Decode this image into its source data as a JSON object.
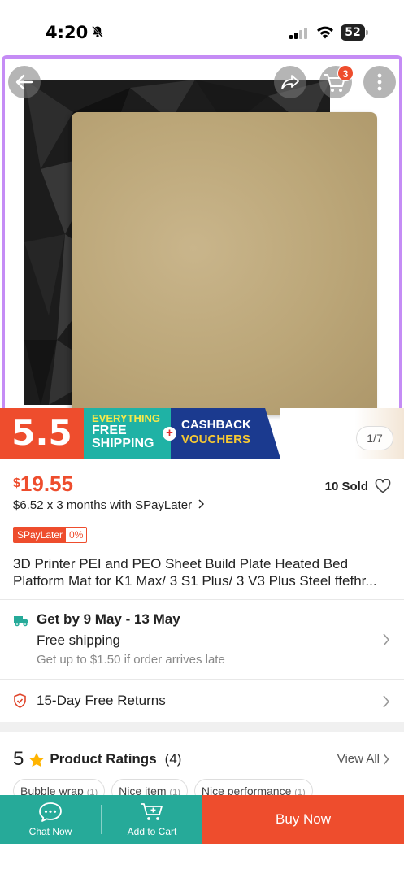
{
  "status_bar": {
    "time": "4:20",
    "battery": "52"
  },
  "hero": {
    "cart_count": "3",
    "page_counter": "1/7"
  },
  "promo": {
    "sale": "5.5",
    "line1": "EVERYTHING",
    "line2": "FREE",
    "line3": "SHIPPING",
    "plus": "+",
    "cash1": "CASHBACK",
    "cash2": "VOUCHERS"
  },
  "product": {
    "currency": "$",
    "price": "19.55",
    "sold": "10 Sold",
    "installment": "$6.52 x 3 months with SPayLater",
    "spl_label": "SPayLater",
    "spl_rate": "0%",
    "title_line1": "3D Printer PEI and PEO Sheet Build Plate Heated Bed",
    "title_line2": "Platform Mat for K1 Max/ 3 S1 Plus/ 3 V3 Plus Steel ffefhr..."
  },
  "shipping": {
    "title": "Get by 9 May - 13 May",
    "free": "Free shipping",
    "note": "Get up to $1.50 if order arrives late"
  },
  "returns": {
    "text": "15-Day Free Returns"
  },
  "ratings": {
    "score": "5",
    "label": "Product Ratings",
    "count": "(4)",
    "view_all": "View All",
    "chips": [
      {
        "label": "Bubble wrap",
        "count": "(1)"
      },
      {
        "label": "Nice item",
        "count": "(1)"
      },
      {
        "label": "Nice performance",
        "count": "(1)"
      }
    ]
  },
  "bottom_bar": {
    "chat": "Chat Now",
    "cart": "Add to Cart",
    "buy": "Buy Now"
  },
  "colors": {
    "accent": "#ee4d2d",
    "teal": "#26aa99"
  }
}
